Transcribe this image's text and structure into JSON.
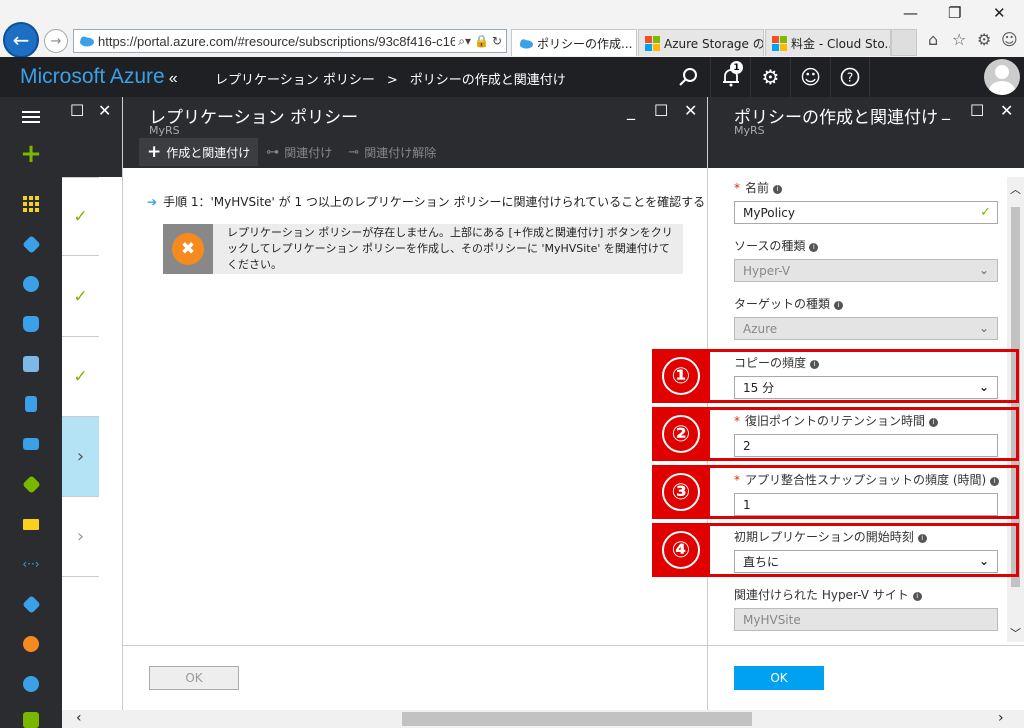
{
  "browser": {
    "url": "https://portal.azure.com/#resource/subscriptions/93c8f416-c16b",
    "tabs": [
      {
        "label": "ポリシーの作成...",
        "active": true
      },
      {
        "label": "Azure Storage の...",
        "active": false
      },
      {
        "label": "料金 - Cloud Sto...",
        "active": false
      }
    ],
    "window_controls": {
      "minimize": "—",
      "restore": "❐",
      "close": "✕"
    }
  },
  "topbar": {
    "brand": "Microsoft Azure",
    "brand_chevron": "«",
    "breadcrumb": [
      "レプリケーション ポリシー",
      "ポリシーの作成と関連付け"
    ],
    "breadcrumb_sep": ">",
    "notification_count": "1"
  },
  "blade1": {
    "title": "レプリケーション ポリシー",
    "subtitle": "MyRS",
    "commands": [
      {
        "label": "作成と関連付け",
        "icon": "plus-icon",
        "enabled": true
      },
      {
        "label": "関連付け",
        "icon": "link-icon",
        "enabled": false
      },
      {
        "label": "関連付け解除",
        "icon": "unlink-icon",
        "enabled": false
      }
    ],
    "step_text": "手順 1：'MyHVSite' が 1 つ以上のレプリケーション ポリシーに関連付けられていることを確認する",
    "info_text": "レプリケーション ポリシーが存在しません。上部にある [+作成と関連付け] ボタンをクリックしてレプリケーション ポリシーを作成し、そのポリシーに 'MyHVSite' を関連付けてください。",
    "ok_label": "OK"
  },
  "blade2": {
    "title": "ポリシーの作成と関連付け",
    "subtitle": "MyRS",
    "fields": {
      "name": {
        "label": "名前",
        "required": true,
        "value": "MyPolicy"
      },
      "source_type": {
        "label": "ソースの種類",
        "value": "Hyper-V"
      },
      "target_type": {
        "label": "ターゲットの種類",
        "value": "Azure"
      },
      "copy_frequency": {
        "label": "コピーの頻度",
        "value": "15 分"
      },
      "recovery_retention": {
        "label": "復旧ポイントのリテンション時間",
        "required": true,
        "value": "2"
      },
      "app_snapshot": {
        "label": "アプリ整合性スナップショットの頻度 (時間)",
        "required": true,
        "value": "1"
      },
      "initial_replication": {
        "label": "初期レプリケーションの開始時刻",
        "value": "直ちに"
      },
      "hyperv_site": {
        "label": "関連付けられた Hyper-V サイト",
        "value": "MyHVSite"
      }
    },
    "ok_label": "OK"
  },
  "annotations": [
    "①",
    "②",
    "③",
    "④"
  ],
  "colors": {
    "azure_blue": "#3ba0e8",
    "dark_bar": "#1e2023",
    "highlight_red": "#e00000",
    "ok_blue": "#00a1f1",
    "check_green": "#7ab800"
  }
}
